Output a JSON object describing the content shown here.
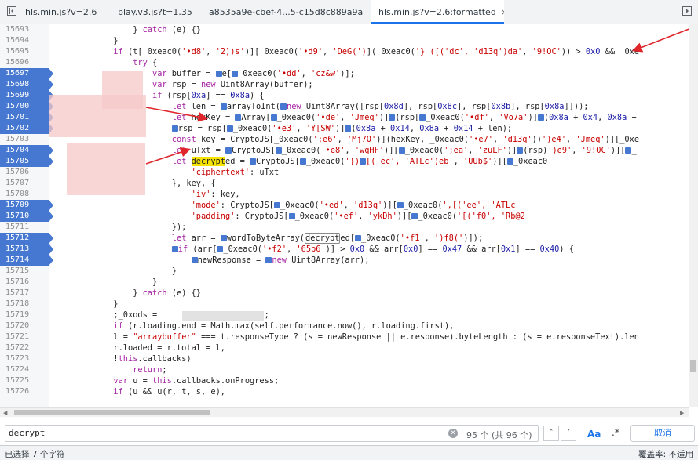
{
  "tabs": [
    {
      "label": "hls.min.js?v=2.6"
    },
    {
      "label": "play.v3.js?t=1.35"
    },
    {
      "label": "a8535a9e-cbef-4...5-c15d8c889a9a"
    },
    {
      "label": "hls.min.js?v=2.6:formatted",
      "close": "×"
    }
  ],
  "lines": [
    "15693",
    "15694",
    "15695",
    "15696",
    "15697",
    "15698",
    "15699",
    "15700",
    "15701",
    "15702",
    "15703",
    "15704",
    "15705",
    "15706",
    "15707",
    "15708",
    "15709",
    "15710",
    "15711",
    "15712",
    "15713",
    "15714",
    "15715",
    "15716",
    "15717",
    "15718",
    "15719",
    "15720",
    "15721",
    "15722",
    "15723",
    "15724",
    "15725",
    "15726"
  ],
  "search": {
    "query": "decrypt",
    "clear": "✕",
    "count": "95 个 (共 96 个)",
    "prev": "˄",
    "next": "˅",
    "match_case": "Aa",
    "regex": ".*",
    "cancel": "取消"
  },
  "status": {
    "left": "已选择 7 个字符",
    "right": "覆盖率: 不适用"
  },
  "colors": {
    "breakpoint": "#4778d1",
    "highlight": "#f7e300",
    "arrow": "#e0262b"
  }
}
